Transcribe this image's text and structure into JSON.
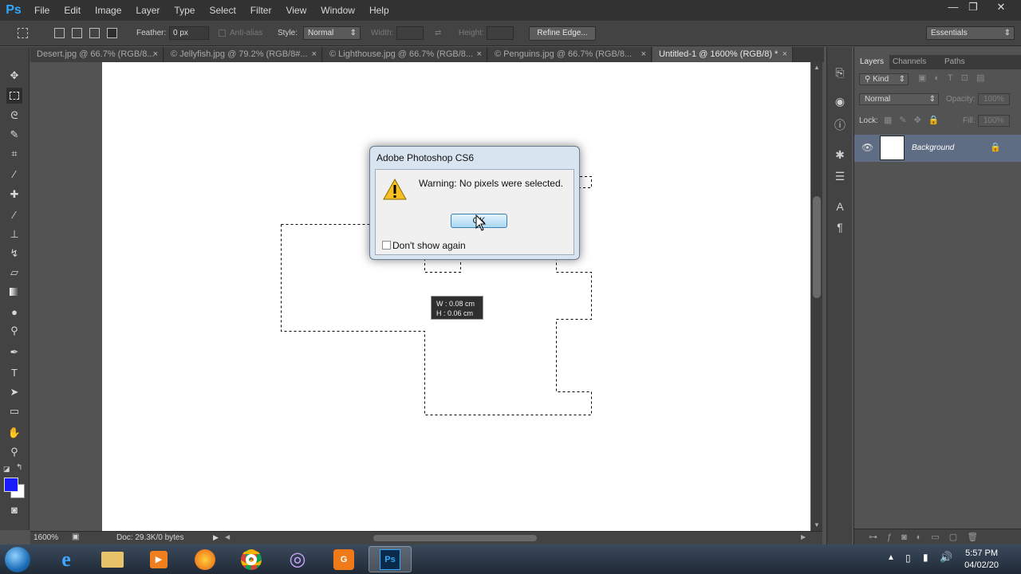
{
  "app": {
    "logo": "Ps"
  },
  "menu": [
    "File",
    "Edit",
    "Image",
    "Layer",
    "Type",
    "Select",
    "Filter",
    "View",
    "Window",
    "Help"
  ],
  "window_controls": {
    "minimize": "—",
    "restore": "❐",
    "close": "✕"
  },
  "options": {
    "feather_label": "Feather:",
    "feather_value": "0 px",
    "antialias_label": "Anti-alias",
    "style_label": "Style:",
    "style_value": "Normal",
    "width_label": "Width:",
    "height_label": "Height:",
    "refine_edge": "Refine Edge...",
    "workspace": "Essentials"
  },
  "tabs": [
    {
      "label": "Desert.jpg @ 66.7% (RGB/8...",
      "close": "×"
    },
    {
      "label": "© Jellyfish.jpg @ 79.2% (RGB/8#...",
      "close": "×"
    },
    {
      "label": "© Lighthouse.jpg @ 66.7% (RGB/8...",
      "close": "×"
    },
    {
      "label": "© Penguins.jpg @ 66.7% (RGB/8...",
      "close": "×"
    },
    {
      "label": "Untitled-1 @ 1600% (RGB/8) *",
      "close": "×"
    }
  ],
  "status": {
    "zoom": "1600%",
    "doc": "Doc: 29.3K/0 bytes"
  },
  "layers_panel": {
    "tabs": [
      "Layers",
      "Channels",
      "Paths"
    ],
    "kind": "Kind",
    "blend_mode": "Normal",
    "opacity_label": "Opacity:",
    "opacity_value": "100%",
    "lock_label": "Lock:",
    "fill_label": "Fill:",
    "fill_value": "100%",
    "layer_name": "Background"
  },
  "dialog": {
    "title": "Adobe Photoshop CS6",
    "message": "Warning: No pixels were selected.",
    "ok": "OK",
    "checkbox": "Don't show again"
  },
  "tooltip": {
    "w": "W :  0.08 cm",
    "h": "H :  0.06 cm"
  },
  "taskbar": {
    "time": "5:57 PM",
    "date": "04/02/20"
  },
  "colors": {
    "foreground": "#1a1aff",
    "background": "#ffffff",
    "accent": "#31a8ff"
  }
}
